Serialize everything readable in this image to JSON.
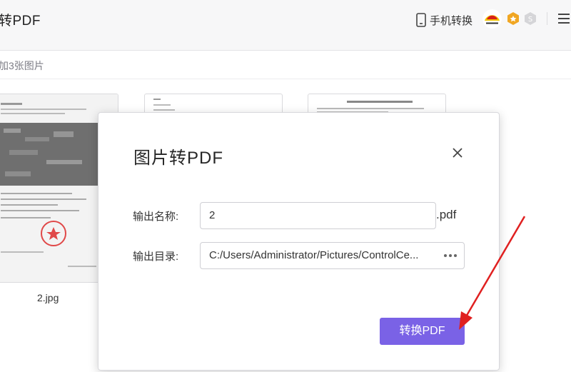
{
  "header": {
    "title": "转PDF",
    "phone_convert_label": "手机转换",
    "icons": [
      "phone-icon",
      "avatar",
      "vip-badge-icon",
      "svip-badge-icon",
      "menu-icon"
    ]
  },
  "subbar": {
    "added_text": "加3张图片"
  },
  "thumbnails": [
    {
      "name": "2.jpg"
    },
    {
      "name": ""
    },
    {
      "name": ""
    }
  ],
  "dialog": {
    "title": "图片转PDF",
    "name_label": "输出名称:",
    "name_value": "2",
    "name_suffix": ".pdf",
    "dir_label": "输出目录:",
    "dir_value": "C:/Users/Administrator/Pictures/ControlCe...",
    "convert_label": "转换PDF"
  },
  "colors": {
    "accent": "#7a62e6",
    "annotation_arrow": "#e02020"
  }
}
